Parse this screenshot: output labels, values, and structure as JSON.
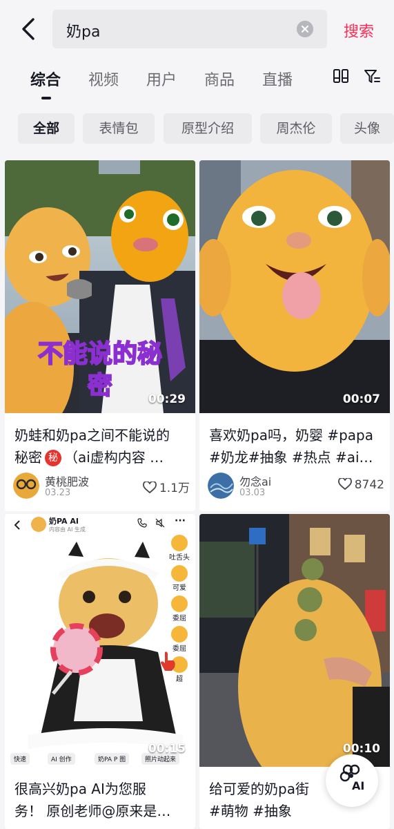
{
  "search": {
    "query": "奶pa",
    "button_label": "搜索"
  },
  "tabs": [
    "综合",
    "视频",
    "用户",
    "商品",
    "直播"
  ],
  "chips": [
    "全部",
    "表情包",
    "原型介绍",
    "周杰伦",
    "头像"
  ],
  "cards": [
    {
      "overlay_text_1": "不能说的秘",
      "overlay_text_2": "密",
      "duration": "00:29",
      "title_line1": "奶蛙和奶pa之间不能说的",
      "title_line2_pre": "秘密",
      "title_badge": "秘",
      "title_line2_post": "（ai虚构内容 …",
      "author": "黄桃肥波",
      "date": "03.23",
      "likes": "1.1万"
    },
    {
      "duration": "00:07",
      "title_line1": "喜欢奶pa吗，奶婴 #papa",
      "title_line2": "#奶龙#抽象 #热点 #ai…",
      "author": "勿念ai",
      "date": "03.03",
      "likes": "8742"
    },
    {
      "chat_name": "奶PA AI",
      "chat_sub": "内容由 AI 生成",
      "reactions": [
        "吐舌头",
        "可爱",
        "委屈",
        "委屈",
        "超"
      ],
      "tools": [
        "快速",
        "AI 创作",
        "奶PA P 图",
        "照片动起来"
      ],
      "duration": "00:15",
      "title_line1": "很高兴奶pa AI为您服",
      "title_line2": "务！ 原创老师@原来是…"
    },
    {
      "duration": "00:10",
      "title_line1": "给可爱的奶pa街",
      "title_line2": "#萌物 #抽象"
    }
  ],
  "ai_fab_label": "AI",
  "colors": {
    "accent": "#fe2c55",
    "background": "#f5f5f7"
  }
}
